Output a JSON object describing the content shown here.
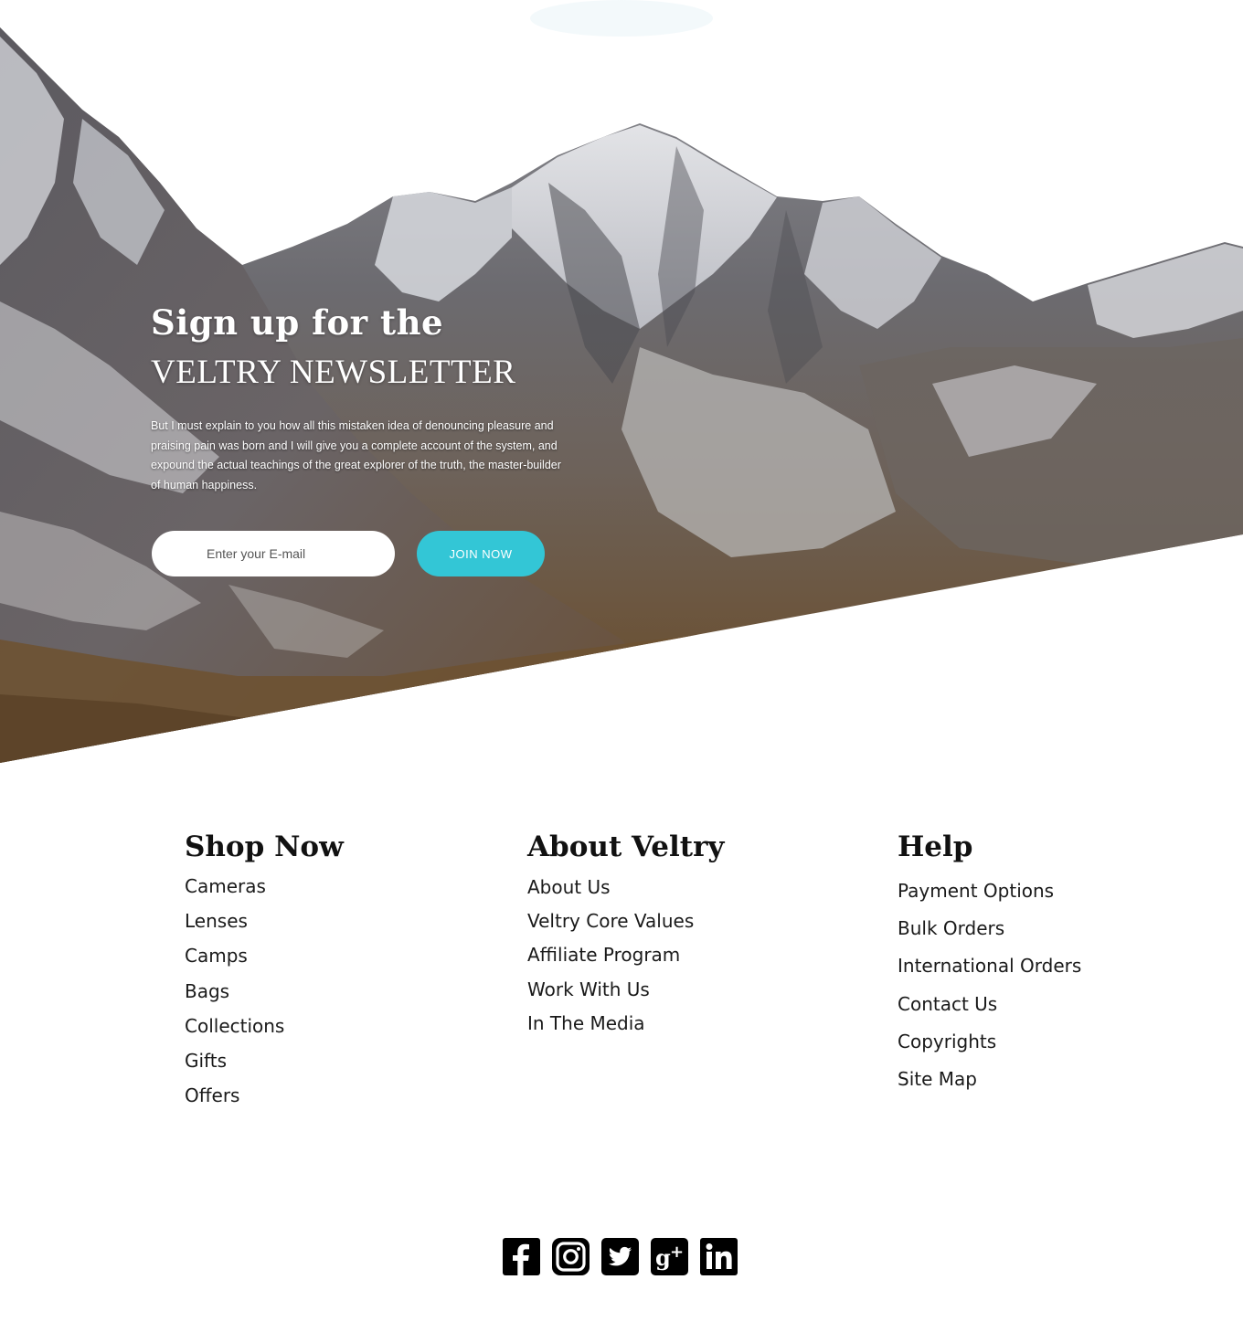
{
  "hero": {
    "title_line1": "Sign up for the",
    "title_line2": "VELTRY NEWSLETTER",
    "description": "But I must explain to you how all this mistaken idea of denouncing pleasure and praising pain was born and I will give you a complete account of the system, and expound the actual teachings of the great explorer of the truth, the master-builder of human happiness.",
    "email_placeholder": "Enter your E-mail",
    "join_label": "JOIN  NOW",
    "accent_color": "#33c6d6"
  },
  "footer": {
    "shop": {
      "title": "Shop Now",
      "items": [
        "Cameras",
        "Lenses",
        "Camps",
        "Bags",
        "Collections",
        "Gifts",
        "Offers"
      ]
    },
    "about": {
      "title": "About Veltry",
      "items": [
        "About Us",
        "Veltry Core Values",
        "Affiliate Program",
        "Work With Us",
        "In The Media"
      ]
    },
    "help": {
      "title": "Help",
      "items": [
        "Payment Options",
        "Bulk Orders",
        "International Orders",
        "Contact Us",
        "Copyrights",
        "Site Map"
      ]
    }
  },
  "social": {
    "icons": [
      "facebook-icon",
      "instagram-icon",
      "twitter-icon",
      "google-plus-icon",
      "linkedin-icon"
    ]
  }
}
